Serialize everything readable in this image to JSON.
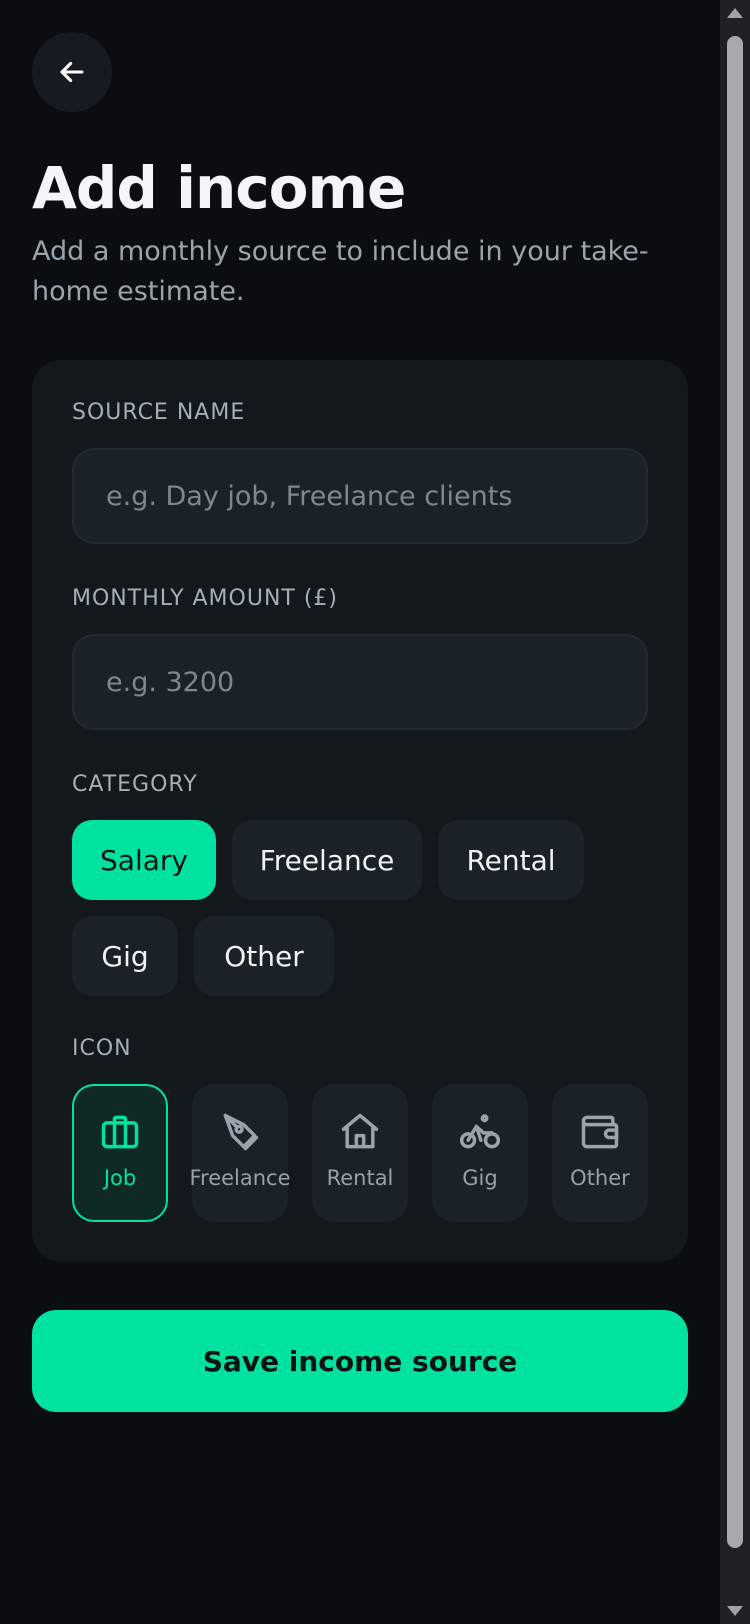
{
  "header": {
    "back_icon": "arrow-left-icon",
    "title": "Add income",
    "subtitle": "Add a monthly source to include in your take-home estimate."
  },
  "form": {
    "source_name": {
      "label": "SOURCE NAME",
      "value": "",
      "placeholder": "e.g. Day job, Freelance clients"
    },
    "monthly_amount": {
      "label": "MONTHLY AMOUNT (£)",
      "value": "",
      "placeholder": "e.g. 3200"
    },
    "category": {
      "label": "CATEGORY",
      "selected": "Salary",
      "options": [
        {
          "label": "Salary"
        },
        {
          "label": "Freelance"
        },
        {
          "label": "Rental"
        },
        {
          "label": "Gig"
        },
        {
          "label": "Other"
        }
      ]
    },
    "icon": {
      "label": "ICON",
      "selected": "Job",
      "options": [
        {
          "label": "Job",
          "icon": "briefcase-icon"
        },
        {
          "label": "Freelance",
          "icon": "pen-nib-icon"
        },
        {
          "label": "Rental",
          "icon": "house-icon"
        },
        {
          "label": "Gig",
          "icon": "bicycle-icon"
        },
        {
          "label": "Other",
          "icon": "wallet-icon"
        }
      ]
    }
  },
  "actions": {
    "save_label": "Save income source"
  },
  "colors": {
    "background": "#0a0e11",
    "card": "#12181c",
    "input": "#1a2228",
    "accent": "#00e3a0",
    "muted_text": "#9aa4ad"
  }
}
